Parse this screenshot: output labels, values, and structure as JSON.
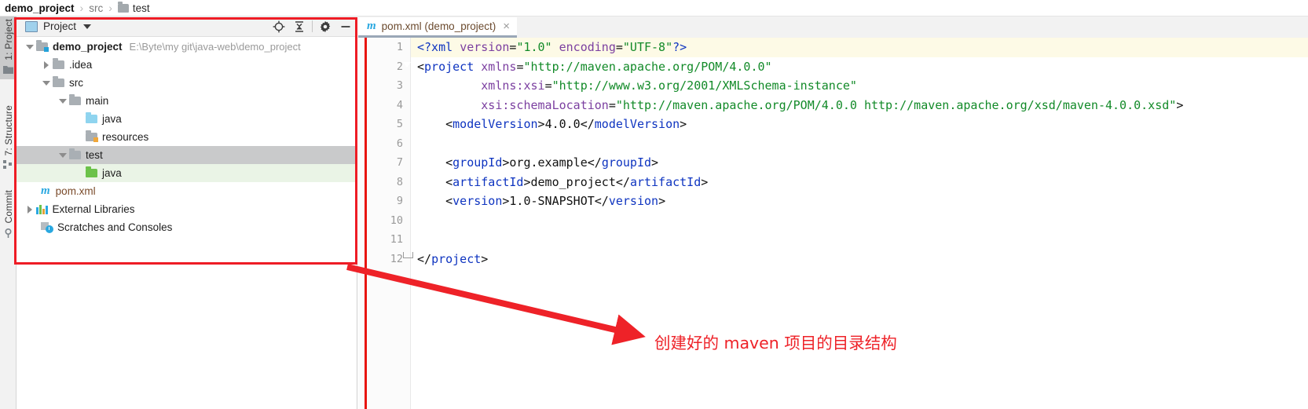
{
  "breadcrumb": {
    "items": [
      {
        "label": "demo_project",
        "style": "bold",
        "icon": ""
      },
      {
        "label": "src",
        "style": "muted",
        "icon": ""
      },
      {
        "label": "test",
        "style": "dark",
        "icon": "folder-icon"
      }
    ],
    "separator": "›"
  },
  "left_strip": {
    "tabs": [
      {
        "label": "1: Project",
        "active": true,
        "icon": "project-icon"
      },
      {
        "label": "7: Structure",
        "active": false,
        "icon": "structure-icon"
      },
      {
        "label": "Commit",
        "active": false,
        "icon": "commit-icon"
      }
    ]
  },
  "project_panel": {
    "title": "Project",
    "window_icon": "project-window-icon",
    "dropdown_icon": "chevron-down-icon",
    "actions": [
      {
        "name": "select-opened-file-icon",
        "tooltip": "Select Opened File"
      },
      {
        "name": "collapse-all-icon",
        "tooltip": "Collapse All"
      },
      {
        "name": "gear-icon",
        "tooltip": "Settings"
      },
      {
        "name": "minimize-icon",
        "tooltip": "Hide"
      }
    ],
    "tree": [
      {
        "label": "demo_project",
        "path": "E:\\Byte\\my git\\java-web\\demo_project",
        "indent": 0,
        "twisty": "down",
        "icon": "folder-module",
        "bold": true,
        "state": "normal"
      },
      {
        "label": ".idea",
        "path": "",
        "indent": 1,
        "twisty": "right",
        "icon": "folder-gray",
        "bold": false,
        "state": "normal"
      },
      {
        "label": "src",
        "path": "",
        "indent": 1,
        "twisty": "down",
        "icon": "folder-gray",
        "bold": false,
        "state": "normal"
      },
      {
        "label": "main",
        "path": "",
        "indent": 2,
        "twisty": "down",
        "icon": "folder-gray",
        "bold": false,
        "state": "normal"
      },
      {
        "label": "java",
        "path": "",
        "indent": 3,
        "twisty": "none",
        "icon": "folder-blue",
        "bold": false,
        "state": "normal"
      },
      {
        "label": "resources",
        "path": "",
        "indent": 3,
        "twisty": "none",
        "icon": "folder-resources",
        "bold": false,
        "state": "normal"
      },
      {
        "label": "test",
        "path": "",
        "indent": 2,
        "twisty": "down",
        "icon": "folder-gray",
        "bold": false,
        "state": "selected"
      },
      {
        "label": "java",
        "path": "",
        "indent": 3,
        "twisty": "none",
        "icon": "folder-green",
        "bold": false,
        "state": "source"
      },
      {
        "label": "pom.xml",
        "path": "",
        "indent": 1,
        "twisty": "none",
        "icon": "maven-icon",
        "bold": false,
        "state": "normal"
      },
      {
        "label": "External Libraries",
        "path": "",
        "indent": 0,
        "twisty": "right",
        "icon": "libraries-icon",
        "bold": false,
        "state": "normal"
      },
      {
        "label": "Scratches and Consoles",
        "path": "",
        "indent": 0,
        "twisty": "none",
        "icon": "scratches-icon",
        "bold": false,
        "state": "normal"
      }
    ]
  },
  "editor": {
    "tab": {
      "title": "pom.xml (demo_project)",
      "icon": "maven-icon",
      "close_icon": "close-icon",
      "close_glyph": "×"
    },
    "caret_line": 1,
    "lines": [
      {
        "num": "1",
        "fold": "",
        "tokens": [
          {
            "t": "<?xml ",
            "c": "xproc"
          },
          {
            "t": "version",
            "c": "xattr"
          },
          {
            "t": "=",
            "c": "xpunc"
          },
          {
            "t": "\"1.0\"",
            "c": "xval"
          },
          {
            "t": " ",
            "c": "xpunc"
          },
          {
            "t": "encoding",
            "c": "xattr"
          },
          {
            "t": "=",
            "c": "xpunc"
          },
          {
            "t": "\"UTF-8\"",
            "c": "xval"
          },
          {
            "t": "?>",
            "c": "xproc"
          }
        ]
      },
      {
        "num": "2",
        "fold": "arrow",
        "tokens": [
          {
            "t": "<",
            "c": "xpunc"
          },
          {
            "t": "project",
            "c": "xtag"
          },
          {
            "t": " ",
            "c": "xpunc"
          },
          {
            "t": "xmlns",
            "c": "xattr"
          },
          {
            "t": "=",
            "c": "xpunc"
          },
          {
            "t": "\"http://maven.apache.org/POM/4.0.0\"",
            "c": "xval"
          }
        ]
      },
      {
        "num": "3",
        "fold": "",
        "tokens": [
          {
            "t": "         ",
            "c": "xpunc"
          },
          {
            "t": "xmlns:xsi",
            "c": "xattr"
          },
          {
            "t": "=",
            "c": "xpunc"
          },
          {
            "t": "\"http://www.w3.org/2001/XMLSchema-instance\"",
            "c": "xval"
          }
        ]
      },
      {
        "num": "4",
        "fold": "",
        "tokens": [
          {
            "t": "         ",
            "c": "xpunc"
          },
          {
            "t": "xsi:schemaLocation",
            "c": "xattr"
          },
          {
            "t": "=",
            "c": "xpunc"
          },
          {
            "t": "\"http://maven.apache.org/POM/4.0.0 http://maven.apache.org/xsd/maven-4.0.0.xsd\"",
            "c": "xval"
          },
          {
            "t": ">",
            "c": "xpunc"
          }
        ]
      },
      {
        "num": "5",
        "fold": "",
        "tokens": [
          {
            "t": "    <",
            "c": "xpunc"
          },
          {
            "t": "modelVersion",
            "c": "xtag"
          },
          {
            "t": ">",
            "c": "xpunc"
          },
          {
            "t": "4.0.0",
            "c": "xtext"
          },
          {
            "t": "</",
            "c": "xpunc"
          },
          {
            "t": "modelVersion",
            "c": "xtag"
          },
          {
            "t": ">",
            "c": "xpunc"
          }
        ]
      },
      {
        "num": "6",
        "fold": "",
        "tokens": [
          {
            "t": "",
            "c": "xpunc"
          }
        ]
      },
      {
        "num": "7",
        "fold": "",
        "tokens": [
          {
            "t": "    <",
            "c": "xpunc"
          },
          {
            "t": "groupId",
            "c": "xtag"
          },
          {
            "t": ">",
            "c": "xpunc"
          },
          {
            "t": "org.example",
            "c": "xtext"
          },
          {
            "t": "</",
            "c": "xpunc"
          },
          {
            "t": "groupId",
            "c": "xtag"
          },
          {
            "t": ">",
            "c": "xpunc"
          }
        ]
      },
      {
        "num": "8",
        "fold": "",
        "tokens": [
          {
            "t": "    <",
            "c": "xpunc"
          },
          {
            "t": "artifactId",
            "c": "xtag"
          },
          {
            "t": ">",
            "c": "xpunc"
          },
          {
            "t": "demo_project",
            "c": "xtext"
          },
          {
            "t": "</",
            "c": "xpunc"
          },
          {
            "t": "artifactId",
            "c": "xtag"
          },
          {
            "t": ">",
            "c": "xpunc"
          }
        ]
      },
      {
        "num": "9",
        "fold": "",
        "tokens": [
          {
            "t": "    <",
            "c": "xpunc"
          },
          {
            "t": "version",
            "c": "xtag"
          },
          {
            "t": ">",
            "c": "xpunc"
          },
          {
            "t": "1.0-SNAPSHOT",
            "c": "xtext"
          },
          {
            "t": "</",
            "c": "xpunc"
          },
          {
            "t": "version",
            "c": "xtag"
          },
          {
            "t": ">",
            "c": "xpunc"
          }
        ]
      },
      {
        "num": "10",
        "fold": "",
        "tokens": [
          {
            "t": "",
            "c": "xpunc"
          }
        ]
      },
      {
        "num": "11",
        "fold": "",
        "tokens": [
          {
            "t": "",
            "c": "xpunc"
          }
        ]
      },
      {
        "num": "12",
        "fold": "minus",
        "tokens": [
          {
            "t": "</",
            "c": "xpunc"
          },
          {
            "t": "project",
            "c": "xtag"
          },
          {
            "t": ">",
            "c": "xpunc"
          }
        ]
      }
    ]
  },
  "annotation": {
    "text": "创建好的 maven 项目的目录结构",
    "color": "#ee2228",
    "box_color": "#ee1c25"
  }
}
